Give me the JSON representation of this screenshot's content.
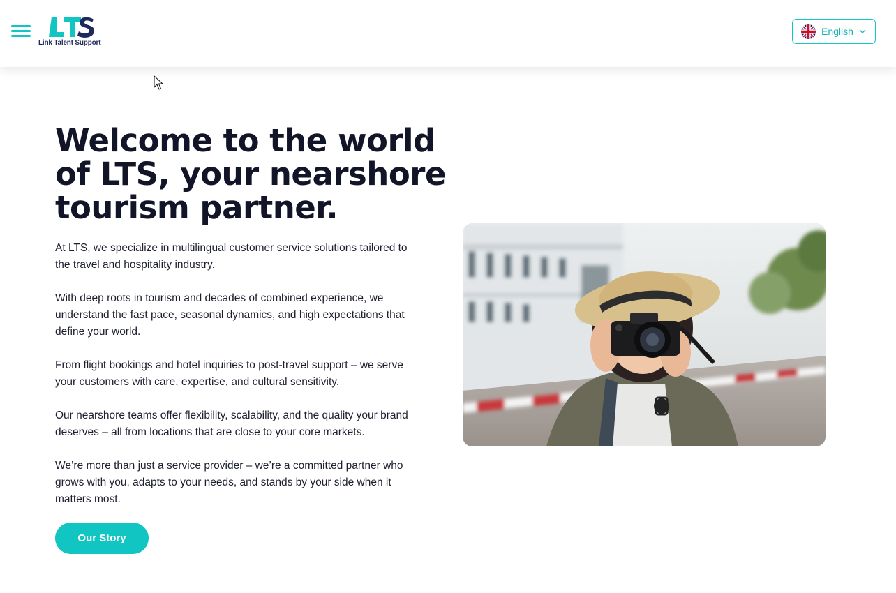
{
  "header": {
    "logo_text": "LTS",
    "logo_subtitle": "Link Talent Support",
    "menu_icon": "hamburger-icon",
    "language": {
      "label": "English",
      "flag_icon": "uk-flag-icon"
    }
  },
  "hero": {
    "title": "Welcome to the world of LTS, your nearshore tourism partner.",
    "paragraphs": [
      "At LTS, we specialize in multilingual customer service solutions tailored to the travel and hospitality industry.",
      "With deep roots in tourism and decades of combined experience, we understand the fast pace, seasonal dynamics, and high expectations that define your world.",
      "From flight bookings and hotel inquiries to post-travel support – we serve your customers with care, expertise, and cultural sensitivity.",
      "Our nearshore teams offer flexibility, scalability, and the quality your brand deserves – all from locations that are close to your core markets.",
      "We’re more than just a service provider – we’re a committed partner who grows with you, adapts to your needs, and stands by your side when it matters most."
    ],
    "cta_label": "Our Story"
  },
  "colors": {
    "accent": "#10c5c2",
    "logo_navy": "#1f2a5c",
    "heading": "#121528"
  }
}
